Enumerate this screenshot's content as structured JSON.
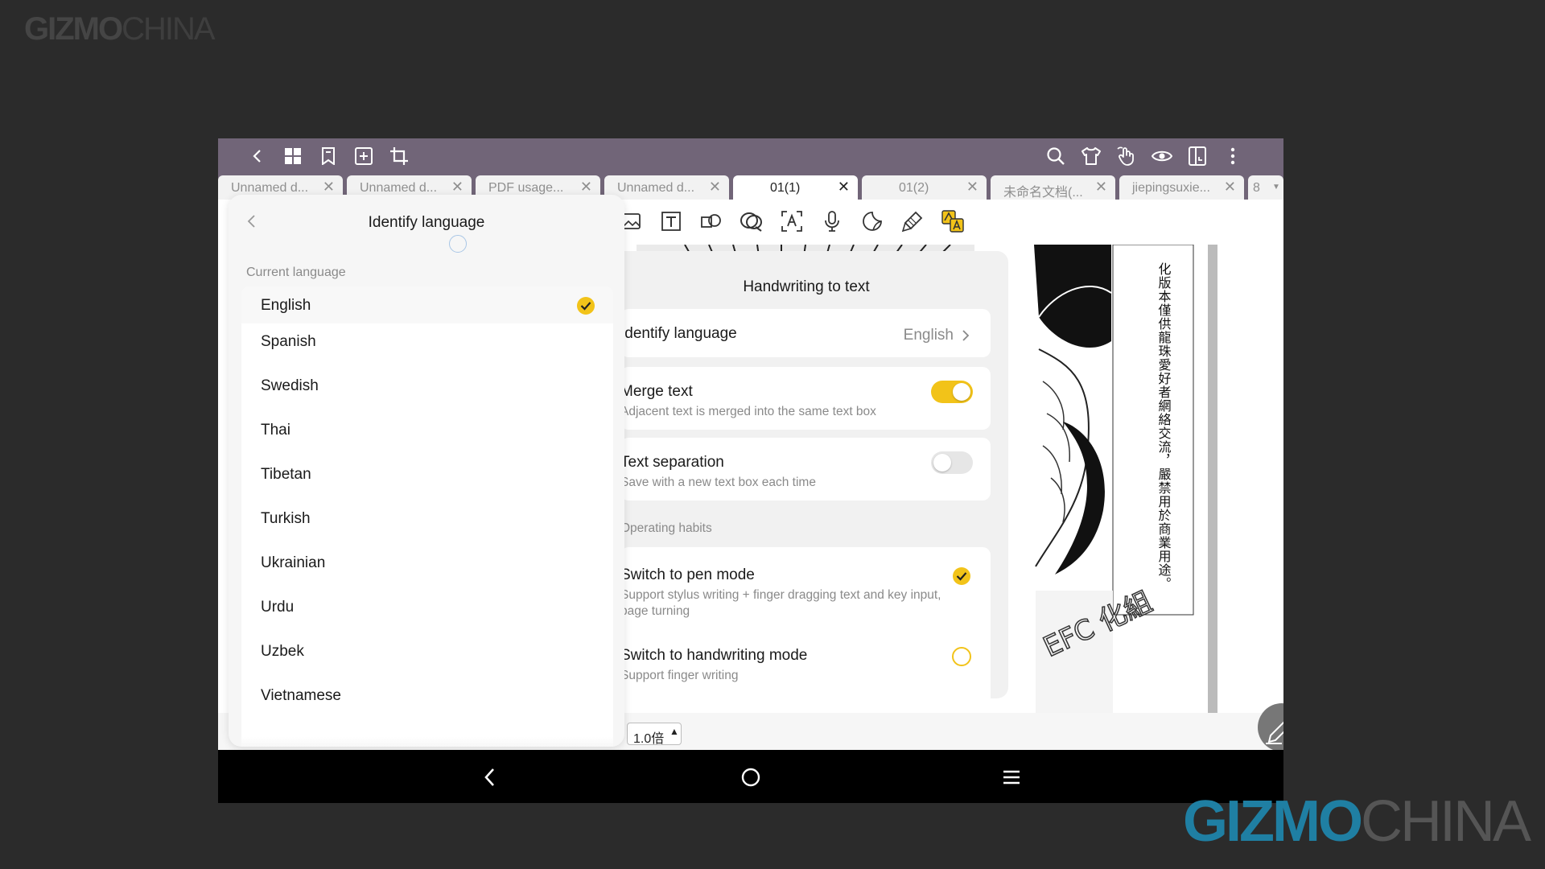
{
  "watermark": {
    "part1": "GIZMO",
    "part2": "CHINA"
  },
  "topbar": {
    "left_icons": [
      "back-icon",
      "grid-icon",
      "bookmark-icon",
      "add-page-icon",
      "crop-icon"
    ],
    "right_icons": [
      "search-icon",
      "shirt-icon",
      "hand-icon",
      "eye-icon",
      "split-view-icon",
      "more-icon"
    ]
  },
  "tabs": [
    {
      "label": "Unnamed d...",
      "active": false
    },
    {
      "label": "Unnamed d...",
      "active": false
    },
    {
      "label": "PDF usage...",
      "active": false
    },
    {
      "label": "Unnamed d...",
      "active": false
    },
    {
      "label": "01(1)",
      "active": true
    },
    {
      "label": "01(2)",
      "active": false
    },
    {
      "label": "未命名文档(...",
      "active": false
    },
    {
      "label": "jiepingsuxie...",
      "active": false
    }
  ],
  "tab_count": "8",
  "tab_close_glyph": "✕",
  "zoom": {
    "value": "1.0倍",
    "caret": "▲"
  },
  "manga_text": "化版本僅供龍珠愛好者網絡交流，嚴禁用於商業用途。",
  "manga_stamp": "EFC 化組",
  "handwriting_panel": {
    "title": "Handwriting to text",
    "identify_language": {
      "label": "Identify language",
      "value": "English"
    },
    "merge_text": {
      "label": "Merge text",
      "desc": "Adjacent text is merged into the same text box",
      "enabled": true
    },
    "text_separation": {
      "label": "Text separation",
      "desc": "Save with a new text box each time",
      "enabled": false
    },
    "operating_habits_label": "Operating habits",
    "pen_mode": {
      "label": "Switch to pen mode",
      "desc": "Support stylus writing + finger dragging text and key input, page turning",
      "selected": true
    },
    "handwriting_mode": {
      "label": "Switch to handwriting mode",
      "desc": "Support finger writing",
      "selected": false
    }
  },
  "language_panel": {
    "title": "Identify language",
    "section": "Current language",
    "languages": [
      "English",
      "Spanish",
      "Swedish",
      "Thai",
      "Tibetan",
      "Turkish",
      "Ukrainian",
      "Urdu",
      "Uzbek",
      "Vietnamese"
    ],
    "selected": "English"
  },
  "colors": {
    "accent": "#f2c319",
    "topbar": "#716578"
  }
}
